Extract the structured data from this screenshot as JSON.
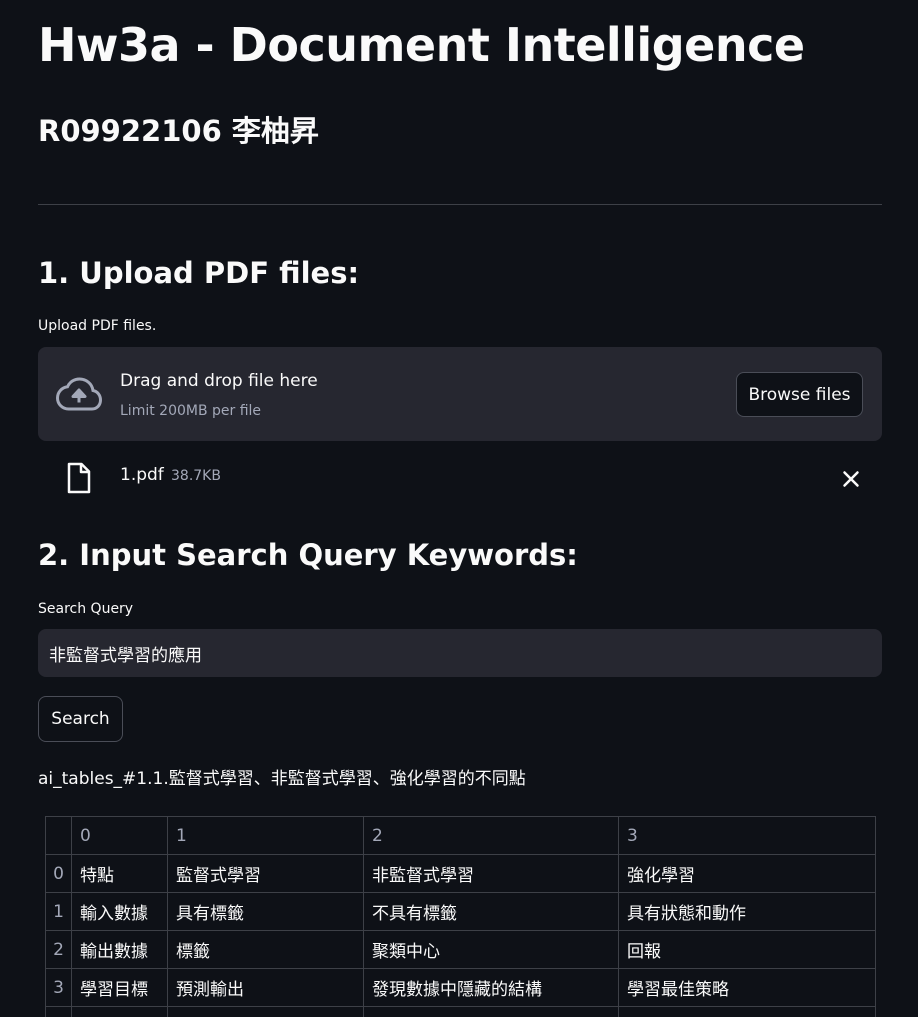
{
  "header": {
    "title": "Hw3a - Document Intelligence",
    "subtitle": "R09922106 李柚昇"
  },
  "upload": {
    "section_title": "1. Upload PDF files:",
    "label": "Upload PDF files.",
    "dropzone_text": "Drag and drop file here",
    "limit_text": "Limit 200MB per file",
    "browse_label": "Browse files",
    "file": {
      "name": "1.pdf",
      "size": "38.7KB"
    }
  },
  "search": {
    "section_title": "2. Input Search Query Keywords:",
    "label": "Search Query",
    "value": "非監督式學習的應用",
    "button_label": "Search"
  },
  "result": {
    "title": "ai_tables_#1.1.監督式學習、非監督式學習、強化學習的不同點",
    "table": {
      "columns": [
        "",
        "0",
        "1",
        "2",
        "3"
      ],
      "rows": [
        [
          "0",
          "特點",
          "監督式學習",
          "非監督式學習",
          "強化學習"
        ],
        [
          "1",
          "輸入數據",
          "具有標籤",
          "不具有標籤",
          "具有狀態和動作"
        ],
        [
          "2",
          "輸出數據",
          "標籤",
          "聚類中心",
          "回報"
        ],
        [
          "3",
          "學習目標",
          "預測輸出",
          "發現數據中隱藏的結構",
          "學習最佳策略"
        ]
      ]
    }
  },
  "icons": {
    "upload": "cloud-upload-icon",
    "file": "file-icon",
    "remove": "close-icon"
  },
  "colors": {
    "background": "#0e1117",
    "surface": "#262730",
    "text": "#fafafa",
    "muted": "#a3a8b8",
    "border": "#3d4047"
  }
}
